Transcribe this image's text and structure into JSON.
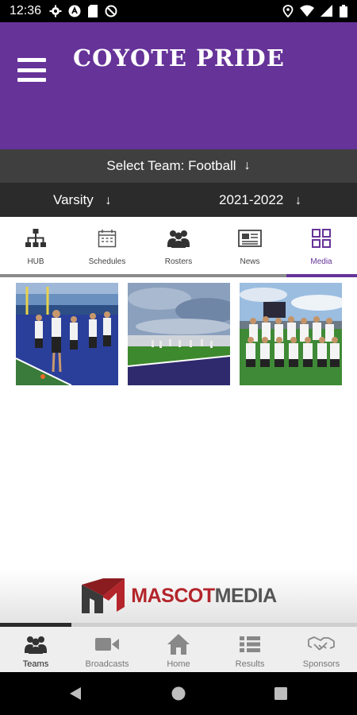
{
  "status": {
    "time": "12:36"
  },
  "header": {
    "title": "COYOTE PRIDE"
  },
  "team_select": {
    "prefix": "Select Team:",
    "team": "Football"
  },
  "filters": {
    "level": "Varsity",
    "season": "2021-2022"
  },
  "tabs": [
    {
      "label": "HUB",
      "icon": "hierarchy-icon"
    },
    {
      "label": "Schedules",
      "icon": "calendar-icon"
    },
    {
      "label": "Rosters",
      "icon": "group-icon"
    },
    {
      "label": "News",
      "icon": "newspaper-icon"
    },
    {
      "label": "Media",
      "icon": "grid-icon",
      "active": true
    }
  ],
  "media": [
    {
      "icon": "photo-players-field"
    },
    {
      "icon": "photo-stadium-practice"
    },
    {
      "icon": "photo-team-group"
    }
  ],
  "sponsor": {
    "name_part1": "MASCOT",
    "name_part2": "MEDIA",
    "carousel_progress": 0.2
  },
  "bottom_nav": [
    {
      "label": "Teams",
      "icon": "teams-icon",
      "active": true
    },
    {
      "label": "Broadcasts",
      "icon": "video-camera-icon"
    },
    {
      "label": "Home",
      "icon": "home-icon"
    },
    {
      "label": "Results",
      "icon": "list-icon"
    },
    {
      "label": "Sponsors",
      "icon": "handshake-icon"
    }
  ],
  "colors": {
    "brand": "#663399",
    "header_bar": "#3f3f3f",
    "filter_bar": "#2b2b2b",
    "sponsor_red": "#b3252b"
  }
}
